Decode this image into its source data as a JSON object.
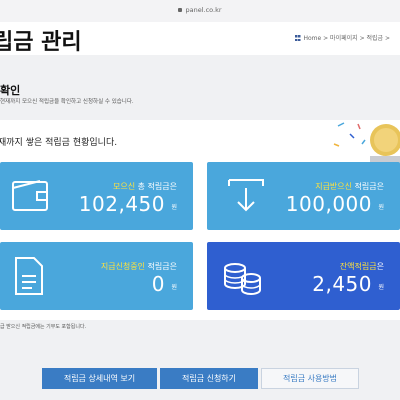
{
  "browser": {
    "url": "panel.co.kr"
  },
  "header": {
    "title": "립금 관리",
    "breadcrumb": "Home > 마이페이지 > 적립금 >"
  },
  "section": {
    "title": "확인",
    "description": "현재까지 모으신 적립금을 확인하고 신청하실 수 있습니다."
  },
  "summary": {
    "heading": "재까지 쌓은 적립금 현황입니다.",
    "cards": [
      {
        "label_highlight": "모으신",
        "label_rest": " 총 적립금은",
        "value": "102,450",
        "unit": "원",
        "icon": "wallet-icon"
      },
      {
        "label_highlight": "지급받으신",
        "label_rest": " 적립금은",
        "value": "100,000",
        "unit": "원",
        "icon": "download-arrow-icon"
      },
      {
        "label_highlight": "지급신청중인",
        "label_rest": " 적립금은",
        "value": "0",
        "unit": "원",
        "icon": "document-icon"
      },
      {
        "label_highlight": "잔액적립금",
        "label_rest": "은",
        "value": "2,450",
        "unit": "원",
        "icon": "coins-icon"
      }
    ],
    "footnote": "급 받으신 적립금에는 기부도 포함됩니다."
  },
  "buttons": {
    "history": "적립금 상세내역 보기",
    "apply": "적립금 신청하기",
    "usage": "적립금 사용방법"
  },
  "colors": {
    "card_blue": "#4aa7dc",
    "card_dark_blue": "#2f5fd0",
    "highlight_yellow": "#ffe23b",
    "button_blue": "#3a7cc4"
  }
}
